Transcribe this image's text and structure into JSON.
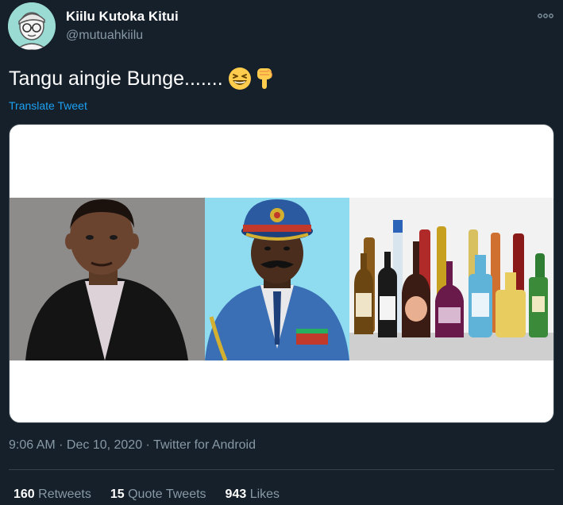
{
  "author": {
    "display_name": "Kiilu Kutoka Kitui",
    "handle": "@mutuahkiilu"
  },
  "tweet": {
    "text": "Tangu aingie Bunge.......",
    "emojis": [
      "grinning-squinting-face-emoji",
      "backhand-index-pointing-down-emoji"
    ],
    "translate_label": "Translate Tweet"
  },
  "media": {
    "photos": [
      "man-in-suit-photo",
      "military-general-photo",
      "liquor-bottles-photo"
    ]
  },
  "meta": {
    "time": "9:06 AM",
    "date": "Dec 10, 2020",
    "source": "Twitter for Android",
    "separator": " · "
  },
  "stats": {
    "retweets_count": "160",
    "retweets_label": "Retweets",
    "quotes_count": "15",
    "quotes_label": "Quote Tweets",
    "likes_count": "943",
    "likes_label": "Likes"
  },
  "colors": {
    "background": "#15202b",
    "secondary_text": "#8899a6",
    "link": "#1da1f2",
    "border": "#38444d",
    "avatar_bg": "#9adbd3"
  }
}
